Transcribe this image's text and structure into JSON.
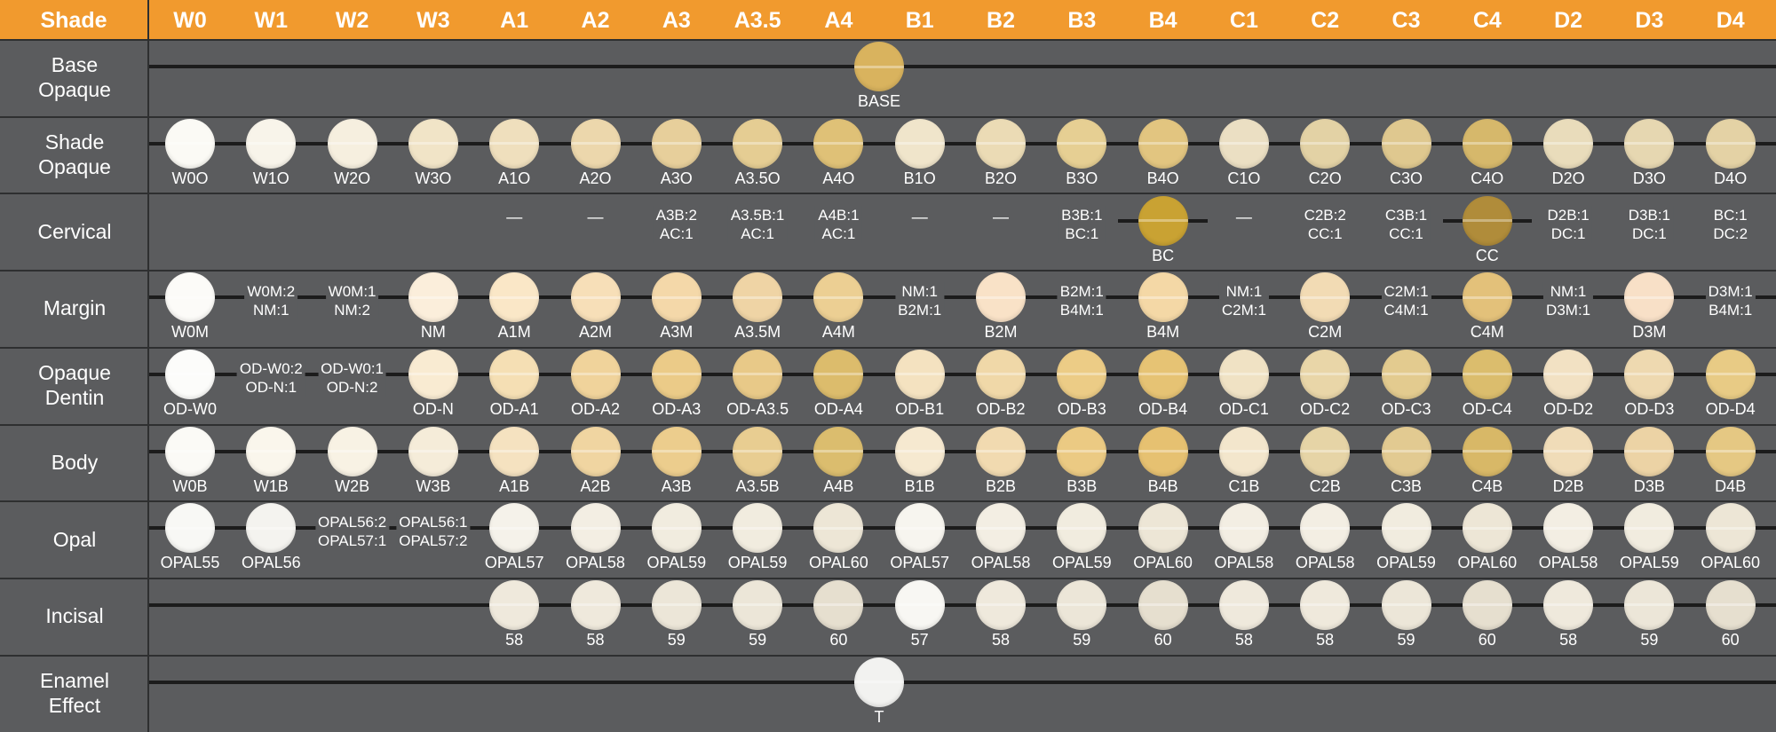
{
  "header": {
    "shade_label": "Shade",
    "columns": [
      "W0",
      "W1",
      "W2",
      "W3",
      "A1",
      "A2",
      "A3",
      "A3.5",
      "A4",
      "B1",
      "B2",
      "B3",
      "B4",
      "C1",
      "C2",
      "C3",
      "C4",
      "D2",
      "D3",
      "D4"
    ]
  },
  "colors": {
    "header_bg": "#f19a2e",
    "panel_bg": "#5b5c5e",
    "line": "#1c1c1c"
  },
  "rows": [
    {
      "label": "Base\nOpaque",
      "cells": [
        {
          "col": 8.5,
          "type": "dot",
          "color": "#d9b35e",
          "caption": "BASE"
        }
      ]
    },
    {
      "label": "Shade\nOpaque",
      "cells": [
        {
          "col": 0,
          "type": "dot",
          "color": "#fbfaf5",
          "caption": "W0O"
        },
        {
          "col": 1,
          "type": "dot",
          "color": "#f8f4ea",
          "caption": "W1O"
        },
        {
          "col": 2,
          "type": "dot",
          "color": "#f6efdf",
          "caption": "W2O"
        },
        {
          "col": 3,
          "type": "dot",
          "color": "#f1e4c7",
          "caption": "W3O"
        },
        {
          "col": 4,
          "type": "dot",
          "color": "#efdfbd",
          "caption": "A1O"
        },
        {
          "col": 5,
          "type": "dot",
          "color": "#ecd7ac",
          "caption": "A2O"
        },
        {
          "col": 6,
          "type": "dot",
          "color": "#e7cf9b",
          "caption": "A3O"
        },
        {
          "col": 7,
          "type": "dot",
          "color": "#e5cd93",
          "caption": "A3.5O"
        },
        {
          "col": 8,
          "type": "dot",
          "color": "#dfc177",
          "caption": "A4O"
        },
        {
          "col": 9,
          "type": "dot",
          "color": "#f0e5cb",
          "caption": "B1O"
        },
        {
          "col": 10,
          "type": "dot",
          "color": "#ebdbb5",
          "caption": "B2O"
        },
        {
          "col": 11,
          "type": "dot",
          "color": "#e6cf93",
          "caption": "B3O"
        },
        {
          "col": 12,
          "type": "dot",
          "color": "#e2c580",
          "caption": "B4O"
        },
        {
          "col": 13,
          "type": "dot",
          "color": "#ebdfc3",
          "caption": "C1O"
        },
        {
          "col": 14,
          "type": "dot",
          "color": "#e3d2a5",
          "caption": "C2O"
        },
        {
          "col": 15,
          "type": "dot",
          "color": "#dfc88f",
          "caption": "C3O"
        },
        {
          "col": 16,
          "type": "dot",
          "color": "#d6b86b",
          "caption": "C4O"
        },
        {
          "col": 17,
          "type": "dot",
          "color": "#e9dcbb",
          "caption": "D2O"
        },
        {
          "col": 18,
          "type": "dot",
          "color": "#e6d7b1",
          "caption": "D3O"
        },
        {
          "col": 19,
          "type": "dot",
          "color": "#e4d2a5",
          "caption": "D4O"
        }
      ]
    },
    {
      "label": "Cervical",
      "cells": [
        {
          "col": 4,
          "type": "dash",
          "text": "—"
        },
        {
          "col": 5,
          "type": "dash",
          "text": "—"
        },
        {
          "col": 6,
          "type": "combo",
          "text": "A3B:2\nAC:1"
        },
        {
          "col": 7,
          "type": "combo",
          "text": "A3.5B:1\nAC:1"
        },
        {
          "col": 8,
          "type": "combo",
          "text": "A4B:1\nAC:1"
        },
        {
          "col": 9,
          "type": "dash",
          "text": "—"
        },
        {
          "col": 10,
          "type": "dash",
          "text": "—"
        },
        {
          "col": 11,
          "type": "combo",
          "text": "B3B:1\nBC:1"
        },
        {
          "col": 12,
          "type": "dot",
          "color": "#c9a233",
          "caption": "BC",
          "line": [
            11.45,
            12.55
          ]
        },
        {
          "col": 13,
          "type": "dash",
          "text": "—"
        },
        {
          "col": 14,
          "type": "combo",
          "text": "C2B:2\nCC:1"
        },
        {
          "col": 15,
          "type": "combo",
          "text": "C3B:1\nCC:1"
        },
        {
          "col": 16,
          "type": "dot",
          "color": "#b08c3a",
          "caption": "CC",
          "line": [
            15.45,
            16.55
          ]
        },
        {
          "col": 17,
          "type": "combo",
          "text": "D2B:1\nDC:1"
        },
        {
          "col": 18,
          "type": "combo",
          "text": "D3B:1\nDC:1"
        },
        {
          "col": 19,
          "type": "combo",
          "text": "BC:1\nDC:2"
        }
      ]
    },
    {
      "label": "Margin",
      "cells": [
        {
          "col": 0,
          "type": "dot",
          "color": "#fcfbf8",
          "caption": "W0M"
        },
        {
          "col": 1,
          "type": "combo",
          "text": "W0M:2\nNM:1"
        },
        {
          "col": 2,
          "type": "combo",
          "text": "W0M:1\nNM:2"
        },
        {
          "col": 3,
          "type": "dot",
          "color": "#fbeedb",
          "caption": "NM"
        },
        {
          "col": 4,
          "type": "dot",
          "color": "#fae7c7",
          "caption": "A1M"
        },
        {
          "col": 5,
          "type": "dot",
          "color": "#f7dfb8",
          "caption": "A2M"
        },
        {
          "col": 6,
          "type": "dot",
          "color": "#f4d8a9",
          "caption": "A3M"
        },
        {
          "col": 7,
          "type": "dot",
          "color": "#efd4a5",
          "caption": "A3.5M"
        },
        {
          "col": 8,
          "type": "dot",
          "color": "#eccf93",
          "caption": "A4M"
        },
        {
          "col": 9,
          "type": "combo",
          "text": "NM:1\nB2M:1"
        },
        {
          "col": 10,
          "type": "dot",
          "color": "#f9e2c7",
          "caption": "B2M"
        },
        {
          "col": 11,
          "type": "combo",
          "text": "B2M:1\nB4M:1"
        },
        {
          "col": 12,
          "type": "dot",
          "color": "#f4d8a6",
          "caption": "B4M"
        },
        {
          "col": 13,
          "type": "combo",
          "text": "NM:1\nC2M:1"
        },
        {
          "col": 14,
          "type": "dot",
          "color": "#f2dbb4",
          "caption": "C2M"
        },
        {
          "col": 15,
          "type": "combo",
          "text": "C2M:1\nC4M:1"
        },
        {
          "col": 16,
          "type": "dot",
          "color": "#e3c17a",
          "caption": "C4M"
        },
        {
          "col": 17,
          "type": "combo",
          "text": "NM:1\nD3M:1"
        },
        {
          "col": 18,
          "type": "dot",
          "color": "#f8e0c7",
          "caption": "D3M"
        },
        {
          "col": 19,
          "type": "combo",
          "text": "D3M:1\nB4M:1"
        }
      ]
    },
    {
      "label": "Opaque\nDentin",
      "cells": [
        {
          "col": 0,
          "type": "dot",
          "color": "#fcfcfa",
          "caption": "OD-W0"
        },
        {
          "col": 1,
          "type": "combo",
          "text": "OD-W0:2\nOD-N:1"
        },
        {
          "col": 2,
          "type": "combo",
          "text": "OD-W0:1\nOD-N:2"
        },
        {
          "col": 3,
          "type": "dot",
          "color": "#f9ebd2",
          "caption": "OD-N"
        },
        {
          "col": 4,
          "type": "dot",
          "color": "#f5dfb4",
          "caption": "OD-A1"
        },
        {
          "col": 5,
          "type": "dot",
          "color": "#f0d39b",
          "caption": "OD-A2"
        },
        {
          "col": 6,
          "type": "dot",
          "color": "#ebcb88",
          "caption": "OD-A3"
        },
        {
          "col": 7,
          "type": "dot",
          "color": "#e8c988",
          "caption": "OD-A3.5"
        },
        {
          "col": 8,
          "type": "dot",
          "color": "#dcbc6c",
          "caption": "OD-A4"
        },
        {
          "col": 9,
          "type": "dot",
          "color": "#f4e2c0",
          "caption": "OD-B1"
        },
        {
          "col": 10,
          "type": "dot",
          "color": "#f0d8a8",
          "caption": "OD-B2"
        },
        {
          "col": 11,
          "type": "dot",
          "color": "#eccc86",
          "caption": "OD-B3"
        },
        {
          "col": 12,
          "type": "dot",
          "color": "#e6c374",
          "caption": "OD-B4"
        },
        {
          "col": 13,
          "type": "dot",
          "color": "#f0e2c4",
          "caption": "OD-C1"
        },
        {
          "col": 14,
          "type": "dot",
          "color": "#e9d6a8",
          "caption": "OD-C2"
        },
        {
          "col": 15,
          "type": "dot",
          "color": "#e3cb8f",
          "caption": "OD-C3"
        },
        {
          "col": 16,
          "type": "dot",
          "color": "#dbbd6d",
          "caption": "OD-C4"
        },
        {
          "col": 17,
          "type": "dot",
          "color": "#f2e1c3",
          "caption": "OD-D2"
        },
        {
          "col": 18,
          "type": "dot",
          "color": "#eed9b0",
          "caption": "OD-D3"
        },
        {
          "col": 19,
          "type": "dot",
          "color": "#e8cb85",
          "caption": "OD-D4"
        }
      ]
    },
    {
      "label": "Body",
      "cells": [
        {
          "col": 0,
          "type": "dot",
          "color": "#fbfaf6",
          "caption": "W0B"
        },
        {
          "col": 1,
          "type": "dot",
          "color": "#faf6ec",
          "caption": "W1B"
        },
        {
          "col": 2,
          "type": "dot",
          "color": "#f8f2e4",
          "caption": "W2B"
        },
        {
          "col": 3,
          "type": "dot",
          "color": "#f5ecd9",
          "caption": "W3B"
        },
        {
          "col": 4,
          "type": "dot",
          "color": "#f5e2c0",
          "caption": "A1B"
        },
        {
          "col": 5,
          "type": "dot",
          "color": "#f0d5a1",
          "caption": "A2B"
        },
        {
          "col": 6,
          "type": "dot",
          "color": "#eccd8d",
          "caption": "A3B"
        },
        {
          "col": 7,
          "type": "dot",
          "color": "#e8cd91",
          "caption": "A3.5B"
        },
        {
          "col": 8,
          "type": "dot",
          "color": "#dbbd6e",
          "caption": "A4B"
        },
        {
          "col": 9,
          "type": "dot",
          "color": "#f6e9d0",
          "caption": "B1B"
        },
        {
          "col": 10,
          "type": "dot",
          "color": "#f1dab0",
          "caption": "B2B"
        },
        {
          "col": 11,
          "type": "dot",
          "color": "#ebca83",
          "caption": "B3B"
        },
        {
          "col": 12,
          "type": "dot",
          "color": "#e6c171",
          "caption": "B4B"
        },
        {
          "col": 13,
          "type": "dot",
          "color": "#f3e6cc",
          "caption": "C1B"
        },
        {
          "col": 14,
          "type": "dot",
          "color": "#e6d4a6",
          "caption": "C2B"
        },
        {
          "col": 15,
          "type": "dot",
          "color": "#e2ca91",
          "caption": "C3B"
        },
        {
          "col": 16,
          "type": "dot",
          "color": "#d8b867",
          "caption": "C4B"
        },
        {
          "col": 17,
          "type": "dot",
          "color": "#f0dcb8",
          "caption": "D2B"
        },
        {
          "col": 18,
          "type": "dot",
          "color": "#ecd3a5",
          "caption": "D3B"
        },
        {
          "col": 19,
          "type": "dot",
          "color": "#e5c883",
          "caption": "D4B"
        }
      ]
    },
    {
      "label": "Opal",
      "cells": [
        {
          "col": 0,
          "type": "dot",
          "color": "#f8f8f5",
          "caption": "OPAL55"
        },
        {
          "col": 1,
          "type": "dot",
          "color": "#f4f3ef",
          "caption": "OPAL56"
        },
        {
          "col": 2,
          "type": "combo",
          "text": "OPAL56:2\nOPAL57:1"
        },
        {
          "col": 3,
          "type": "combo",
          "text": "OPAL56:1\nOPAL57:2"
        },
        {
          "col": 4,
          "type": "dot",
          "color": "#f5f2ea",
          "caption": "OPAL57"
        },
        {
          "col": 5,
          "type": "dot",
          "color": "#f3eee3",
          "caption": "OPAL58"
        },
        {
          "col": 6,
          "type": "dot",
          "color": "#f1ecdf",
          "caption": "OPAL59"
        },
        {
          "col": 7,
          "type": "dot",
          "color": "#f1ecdf",
          "caption": "OPAL59"
        },
        {
          "col": 8,
          "type": "dot",
          "color": "#ede6d6",
          "caption": "OPAL60"
        },
        {
          "col": 9,
          "type": "dot",
          "color": "#f7f5ef",
          "caption": "OPAL57"
        },
        {
          "col": 10,
          "type": "dot",
          "color": "#f3eee3",
          "caption": "OPAL58"
        },
        {
          "col": 11,
          "type": "dot",
          "color": "#f1ecdf",
          "caption": "OPAL59"
        },
        {
          "col": 12,
          "type": "dot",
          "color": "#ede6d6",
          "caption": "OPAL60"
        },
        {
          "col": 13,
          "type": "dot",
          "color": "#f3eee3",
          "caption": "OPAL58"
        },
        {
          "col": 14,
          "type": "dot",
          "color": "#f3eee3",
          "caption": "OPAL58"
        },
        {
          "col": 15,
          "type": "dot",
          "color": "#f1ecdf",
          "caption": "OPAL59"
        },
        {
          "col": 16,
          "type": "dot",
          "color": "#ede6d6",
          "caption": "OPAL60"
        },
        {
          "col": 17,
          "type": "dot",
          "color": "#f3eee3",
          "caption": "OPAL58"
        },
        {
          "col": 18,
          "type": "dot",
          "color": "#f1ecdf",
          "caption": "OPAL59"
        },
        {
          "col": 19,
          "type": "dot",
          "color": "#ede6d6",
          "caption": "OPAL60"
        }
      ]
    },
    {
      "label": "Incisal",
      "cells": [
        {
          "col": 4,
          "type": "dot",
          "color": "#efe9dc",
          "caption": "58"
        },
        {
          "col": 5,
          "type": "dot",
          "color": "#efe9dc",
          "caption": "58"
        },
        {
          "col": 6,
          "type": "dot",
          "color": "#ece6d8",
          "caption": "59"
        },
        {
          "col": 7,
          "type": "dot",
          "color": "#ece6d8",
          "caption": "59"
        },
        {
          "col": 8,
          "type": "dot",
          "color": "#e6dfcf",
          "caption": "60"
        },
        {
          "col": 9,
          "type": "dot",
          "color": "#f8f7f3",
          "caption": "57"
        },
        {
          "col": 10,
          "type": "dot",
          "color": "#efe9dc",
          "caption": "58"
        },
        {
          "col": 11,
          "type": "dot",
          "color": "#ece6d8",
          "caption": "59"
        },
        {
          "col": 12,
          "type": "dot",
          "color": "#e6dfcf",
          "caption": "60"
        },
        {
          "col": 13,
          "type": "dot",
          "color": "#efe9dc",
          "caption": "58"
        },
        {
          "col": 14,
          "type": "dot",
          "color": "#efe9dc",
          "caption": "58"
        },
        {
          "col": 15,
          "type": "dot",
          "color": "#ece6d8",
          "caption": "59"
        },
        {
          "col": 16,
          "type": "dot",
          "color": "#e6dfcf",
          "caption": "60"
        },
        {
          "col": 17,
          "type": "dot",
          "color": "#efe9dc",
          "caption": "58"
        },
        {
          "col": 18,
          "type": "dot",
          "color": "#ece6d8",
          "caption": "59"
        },
        {
          "col": 19,
          "type": "dot",
          "color": "#e6dfcf",
          "caption": "60"
        }
      ]
    },
    {
      "label": "Enamel\nEffect",
      "cells": [
        {
          "col": 8.5,
          "type": "dot",
          "color": "#f2f2f0",
          "caption": "T"
        }
      ]
    }
  ]
}
